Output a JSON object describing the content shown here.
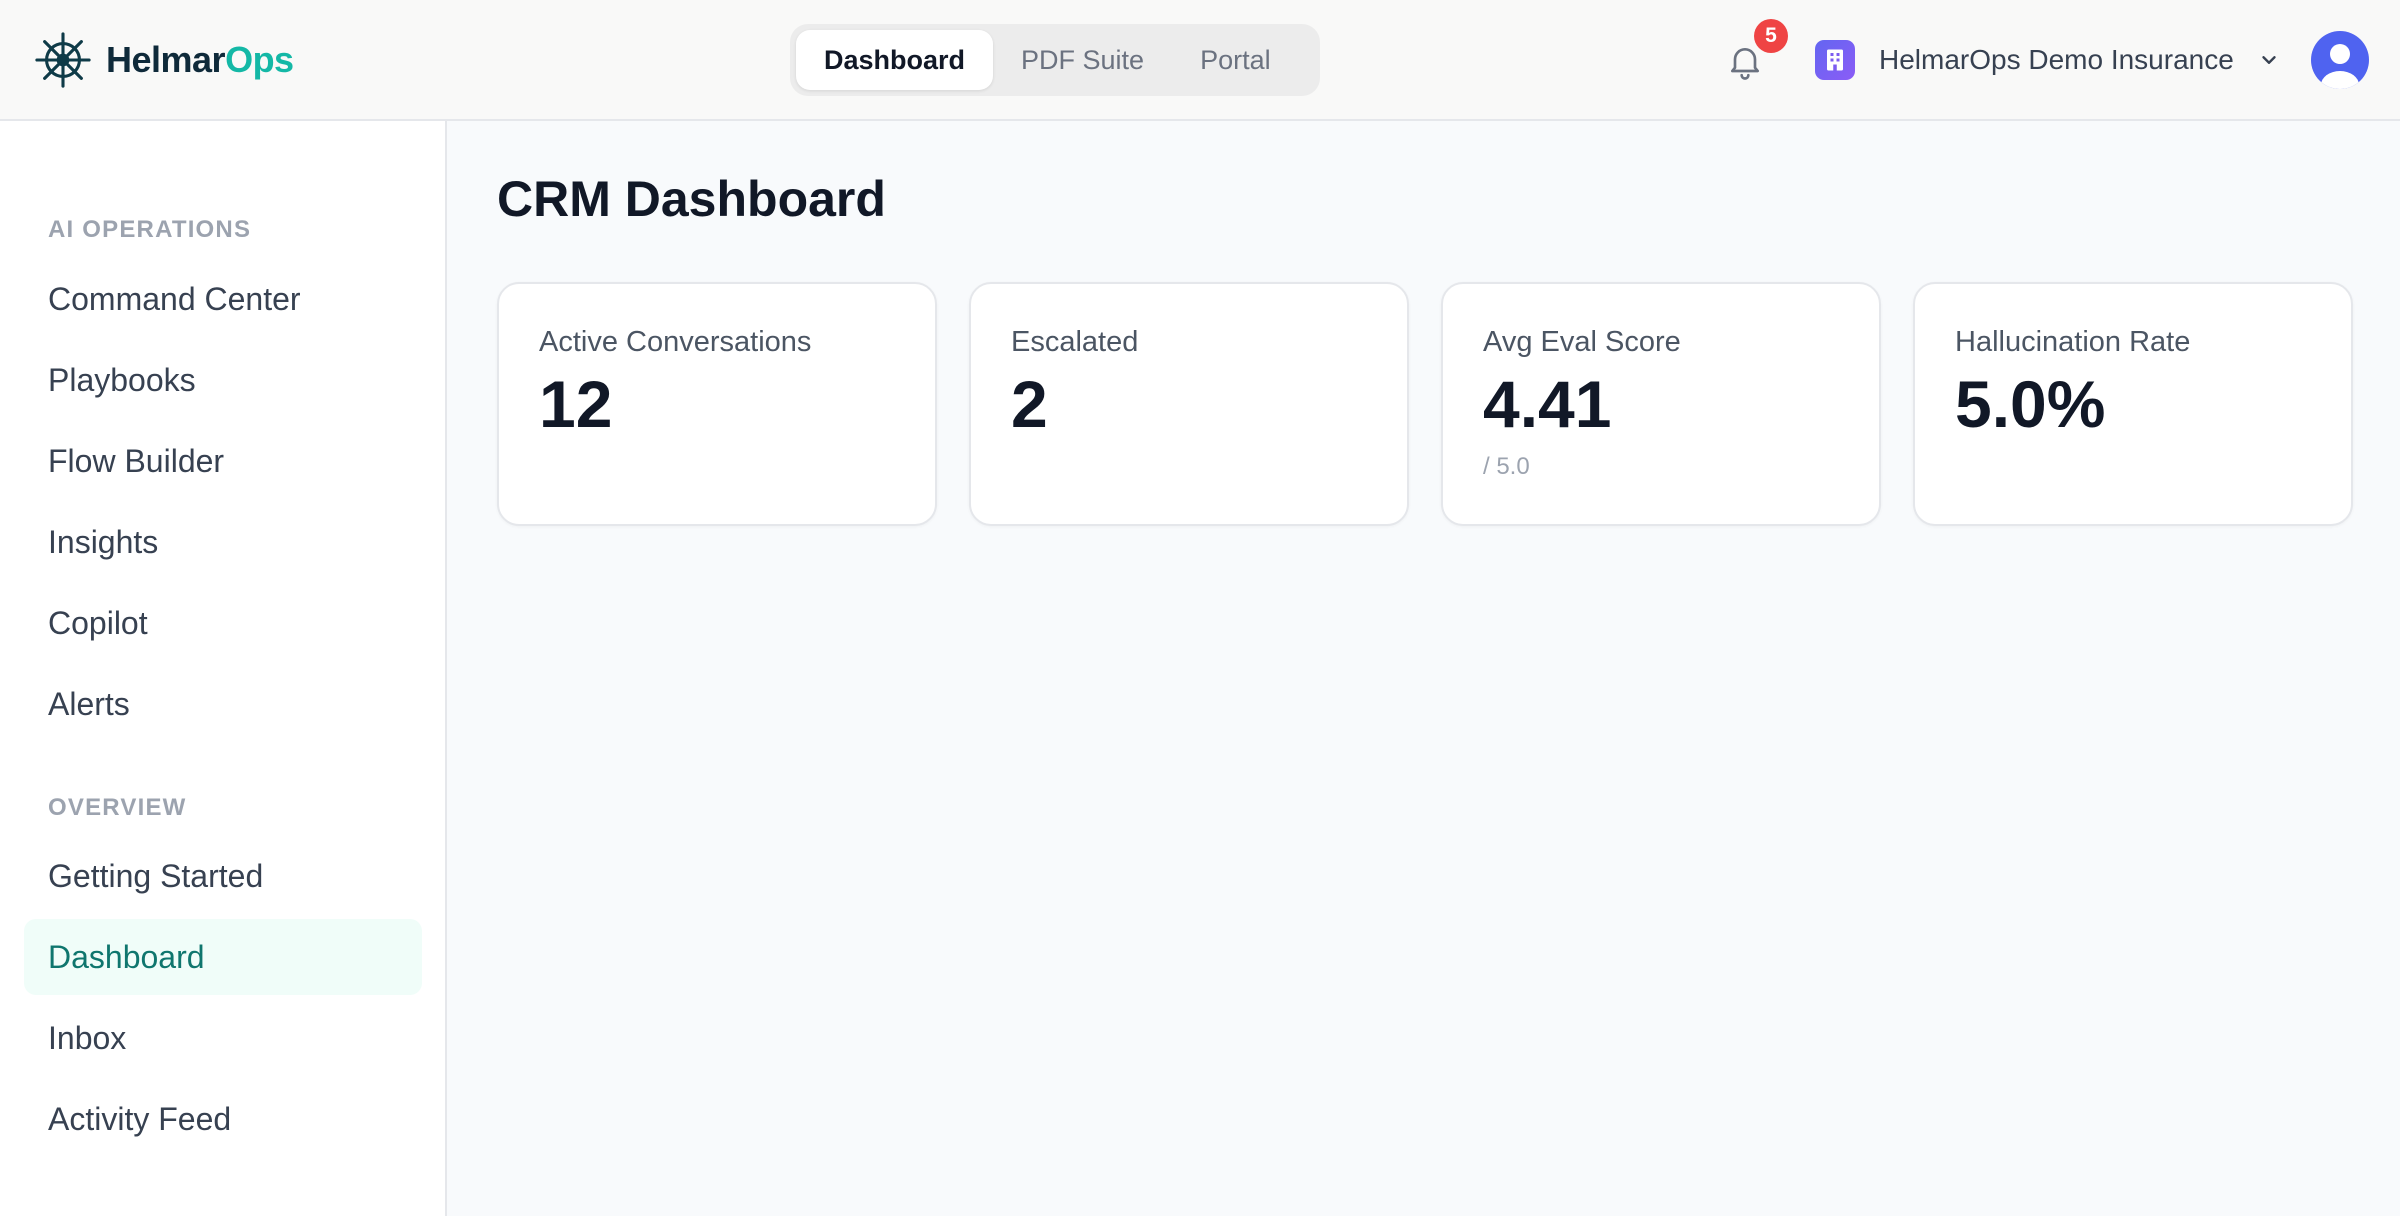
{
  "app": {
    "brand_part1": "Helmar",
    "brand_part2": "Ops"
  },
  "header": {
    "tabs": [
      {
        "label": "Dashboard",
        "active": true
      },
      {
        "label": "PDF Suite",
        "active": false
      },
      {
        "label": "Portal",
        "active": false
      }
    ],
    "notifications_count": "5",
    "org_name": "HelmarOps Demo Insurance"
  },
  "sidebar": {
    "sections": [
      {
        "label": "AI OPERATIONS",
        "items": [
          {
            "label": "Command Center"
          },
          {
            "label": "Playbooks"
          },
          {
            "label": "Flow Builder"
          },
          {
            "label": "Insights"
          },
          {
            "label": "Copilot"
          },
          {
            "label": "Alerts"
          }
        ]
      },
      {
        "label": "OVERVIEW",
        "items": [
          {
            "label": "Getting Started"
          },
          {
            "label": "Dashboard",
            "active": true
          },
          {
            "label": "Inbox"
          },
          {
            "label": "Activity Feed"
          }
        ]
      }
    ]
  },
  "main": {
    "title": "CRM Dashboard",
    "stats": [
      {
        "label": "Active Conversations",
        "value": "12"
      },
      {
        "label": "Escalated",
        "value": "2"
      },
      {
        "label": "Avg Eval Score",
        "value": "4.41",
        "sub": "/ 5.0"
      },
      {
        "label": "Hallucination Rate",
        "value": "5.0%"
      }
    ]
  },
  "colors": {
    "accent": "#14b8a6",
    "brand_dark": "#0f2a3a",
    "active_nav_bg": "#f0fdf9",
    "active_nav_text": "#0f766e",
    "badge": "#ef4444",
    "avatar": "#4f63f0"
  },
  "icons": {
    "logo": "ship-wheel-icon",
    "notifications": "bell-icon",
    "org": "building-icon",
    "org_menu": "chevron-down-icon",
    "user": "user-avatar-icon"
  }
}
